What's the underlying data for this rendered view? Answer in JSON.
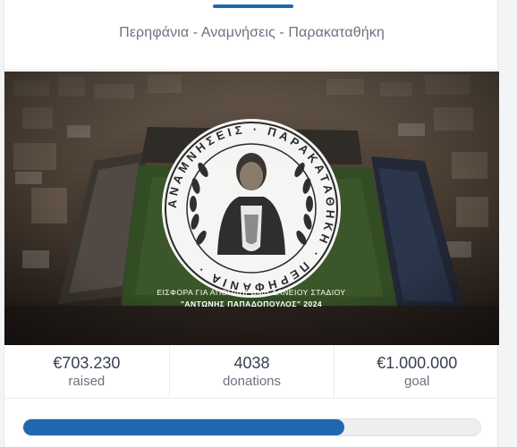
{
  "campaign": {
    "subtitle": "Περηφάνια - Αναμνήσεις - Παρακαταθήκη"
  },
  "hero": {
    "logo_ring_text": "ΑΝΑΜΝΗΣΕΙΣ · ΠΑΡΑΚΑΤΑΘΗΚΗ · ΠΕΡΗΦΑΝΙΑ ·",
    "caption_line1": "ΕΙΣΦΟΡΑ ΓΙΑ ΑΠΟΠΛΗΡΩΜΗ ΔΑΝΕΙΟΥ ΣΤΑΔΙΟΥ",
    "caption_line2": "\"ΑΝΤΩΝΗΣ ΠΑΠΑΔΟΠΟΥΛΟΣ\" 2024"
  },
  "stats": [
    {
      "value": "€703.230",
      "label": "raised"
    },
    {
      "value": "4038",
      "label": "donations"
    },
    {
      "value": "€1.000.000",
      "label": "goal"
    }
  ],
  "progress": {
    "fraction": 0.7032
  },
  "colors": {
    "accent": "#1f68b0",
    "track": "#edeef0"
  }
}
